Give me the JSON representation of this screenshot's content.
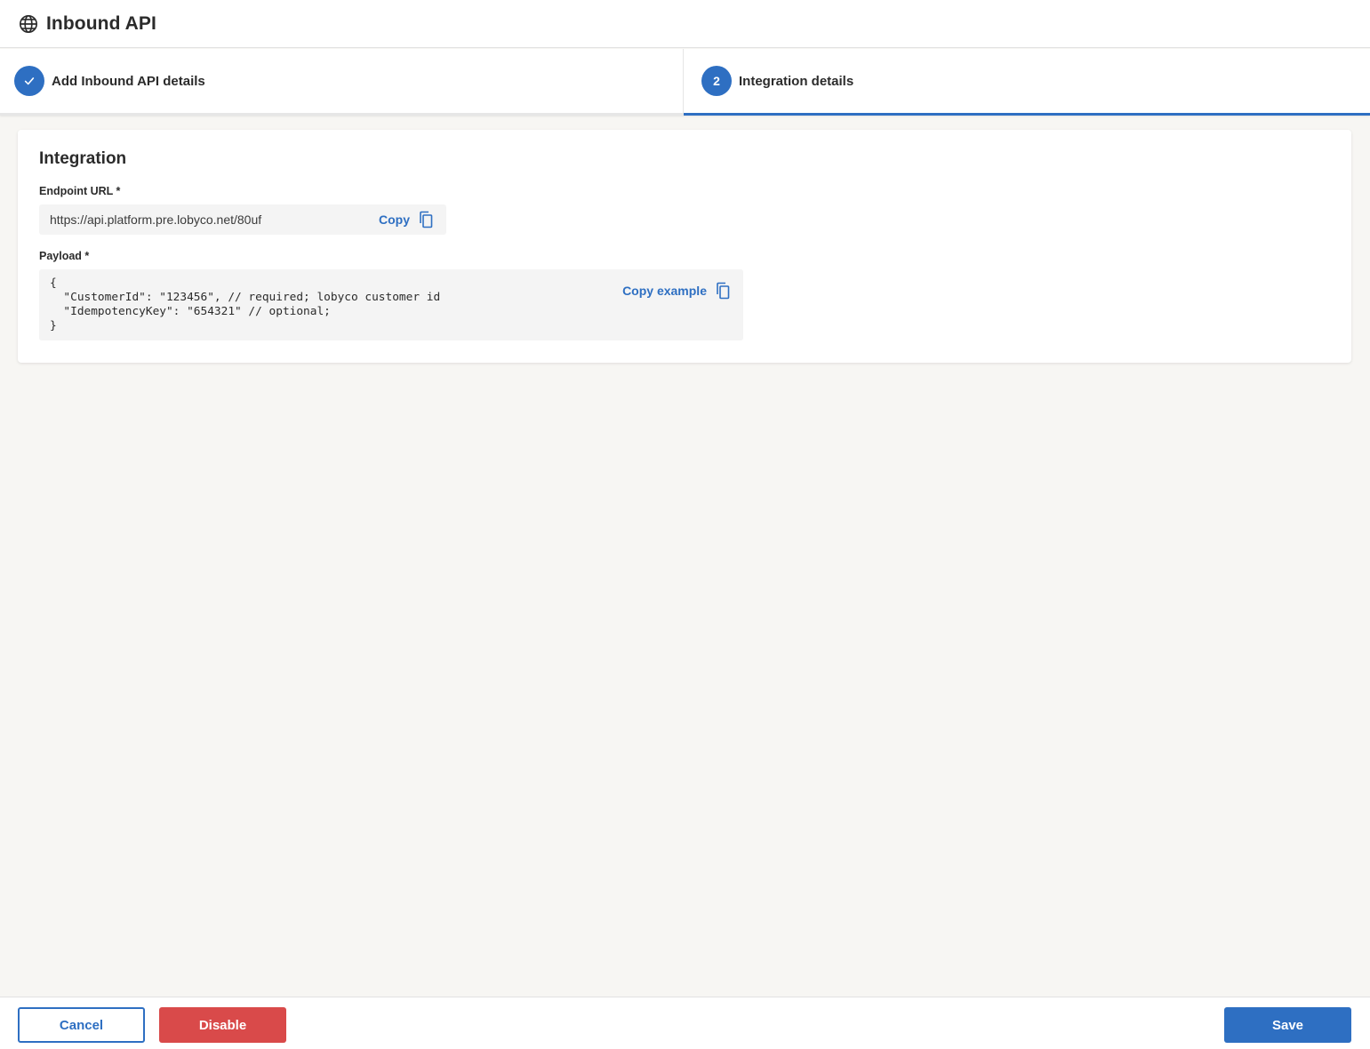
{
  "header": {
    "title": "Inbound API",
    "icon": "globe-icon"
  },
  "stepper": {
    "steps": [
      {
        "label": "Add Inbound API details",
        "status": "completed",
        "marker": "✓"
      },
      {
        "label": "Integration details",
        "status": "active",
        "marker": "2"
      }
    ]
  },
  "integration": {
    "title": "Integration",
    "endpoint": {
      "label": "Endpoint URL *",
      "value": "https://api.platform.pre.lobyco.net/80uf",
      "copy_label": "Copy"
    },
    "payload": {
      "label": "Payload *",
      "code": "{\n  \"CustomerId\": \"123456\", // required; lobyco customer id\n  \"IdempotencyKey\": \"654321\" // optional;\n}",
      "copy_label": "Copy example"
    }
  },
  "footer": {
    "cancel_label": "Cancel",
    "disable_label": "Disable",
    "save_label": "Save"
  },
  "colors": {
    "primary": "#2e6fc2",
    "danger": "#d94a4a",
    "background": "#f7f6f3"
  }
}
